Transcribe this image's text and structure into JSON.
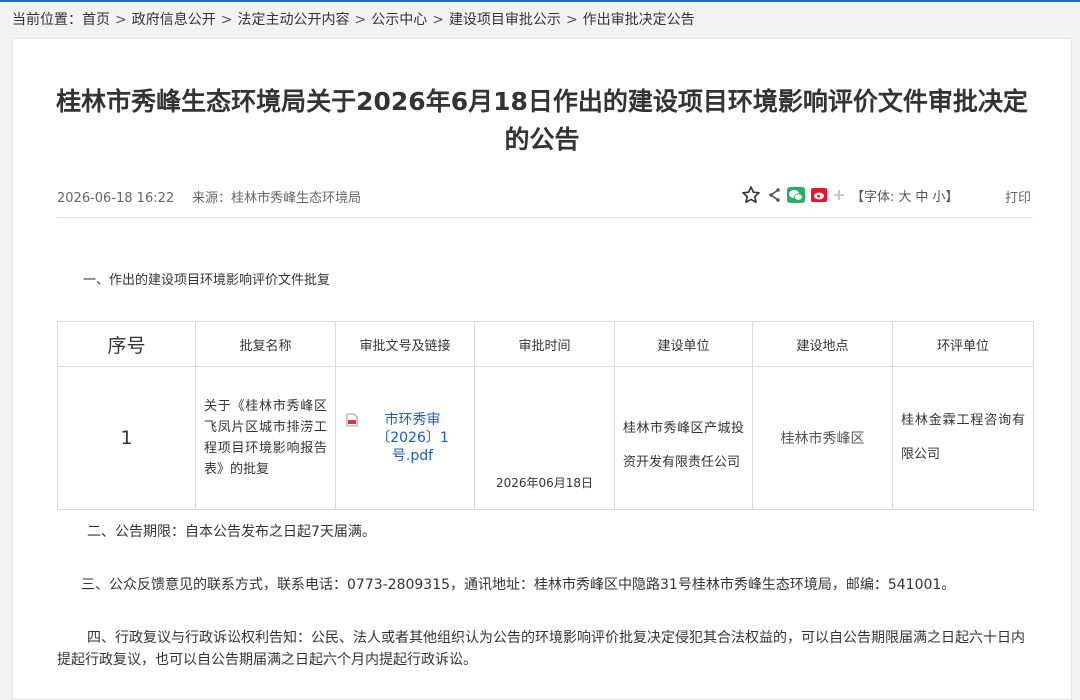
{
  "breadcrumb": {
    "prefix": "当前位置：",
    "items": [
      "首页",
      "政府信息公开",
      "法定主动公开内容",
      "公示中心",
      "建设项目审批公示",
      "作出审批决定公告"
    ],
    "separator": ">"
  },
  "article": {
    "title": "桂林市秀峰生态环境局关于2026年6月18日作出的建设项目环境影响评价文件审批决定的公告",
    "datetime": "2026-06-18 16:22",
    "source_label": "来源：",
    "source": "桂林市秀峰生态环境局"
  },
  "toolbar": {
    "font_label": "【字体:",
    "font_large": "大",
    "font_medium": "中",
    "font_small": "小",
    "font_close": "】",
    "print_label": "打印",
    "icons": [
      "star-icon",
      "share-icon",
      "wechat-icon",
      "weibo-icon",
      "plus-icon"
    ]
  },
  "section1": "一、作出的建设项目环境影响评价文件批复",
  "table": {
    "headers": [
      "序号",
      "批复名称",
      "审批文号及链接",
      "审批时间",
      "建设单位",
      "建设地点",
      "环评单位"
    ],
    "rows": [
      {
        "no": "1",
        "name": "关于《桂林市秀峰区飞凤片区城市排涝工程项目环境影响报告表》的批复",
        "doc_link": "市环秀审〔2026〕1号.pdf",
        "date": "2026年06月18日",
        "builder": "桂林市秀峰区产城投资开发有限责任公司",
        "location": "桂林市秀峰区",
        "eia_unit": "桂林金霖工程咨询有限公司"
      }
    ]
  },
  "para2": "二、公告期限：自本公告发布之日起7天届满。",
  "para3": "三、公众反馈意见的联系方式，联系电话：0773-2809315，通讯地址：桂林市秀峰区中隐路31号桂林市秀峰生态环境局，邮编：541001。",
  "para4": "四、行政复议与行政诉讼权利告知：公民、法人或者其他组织认为公告的环境影响评价批复决定侵犯其合法权益的，可以自公告期限届满之日起六十日内提起行政复议，也可以自公告期届满之日起六个月内提起行政诉讼。",
  "colors": {
    "accent": "#1f6fc1",
    "link": "#1a5fb4",
    "wechat": "#2aae67",
    "weibo": "#e6162d",
    "pdf": "#d9363e"
  }
}
